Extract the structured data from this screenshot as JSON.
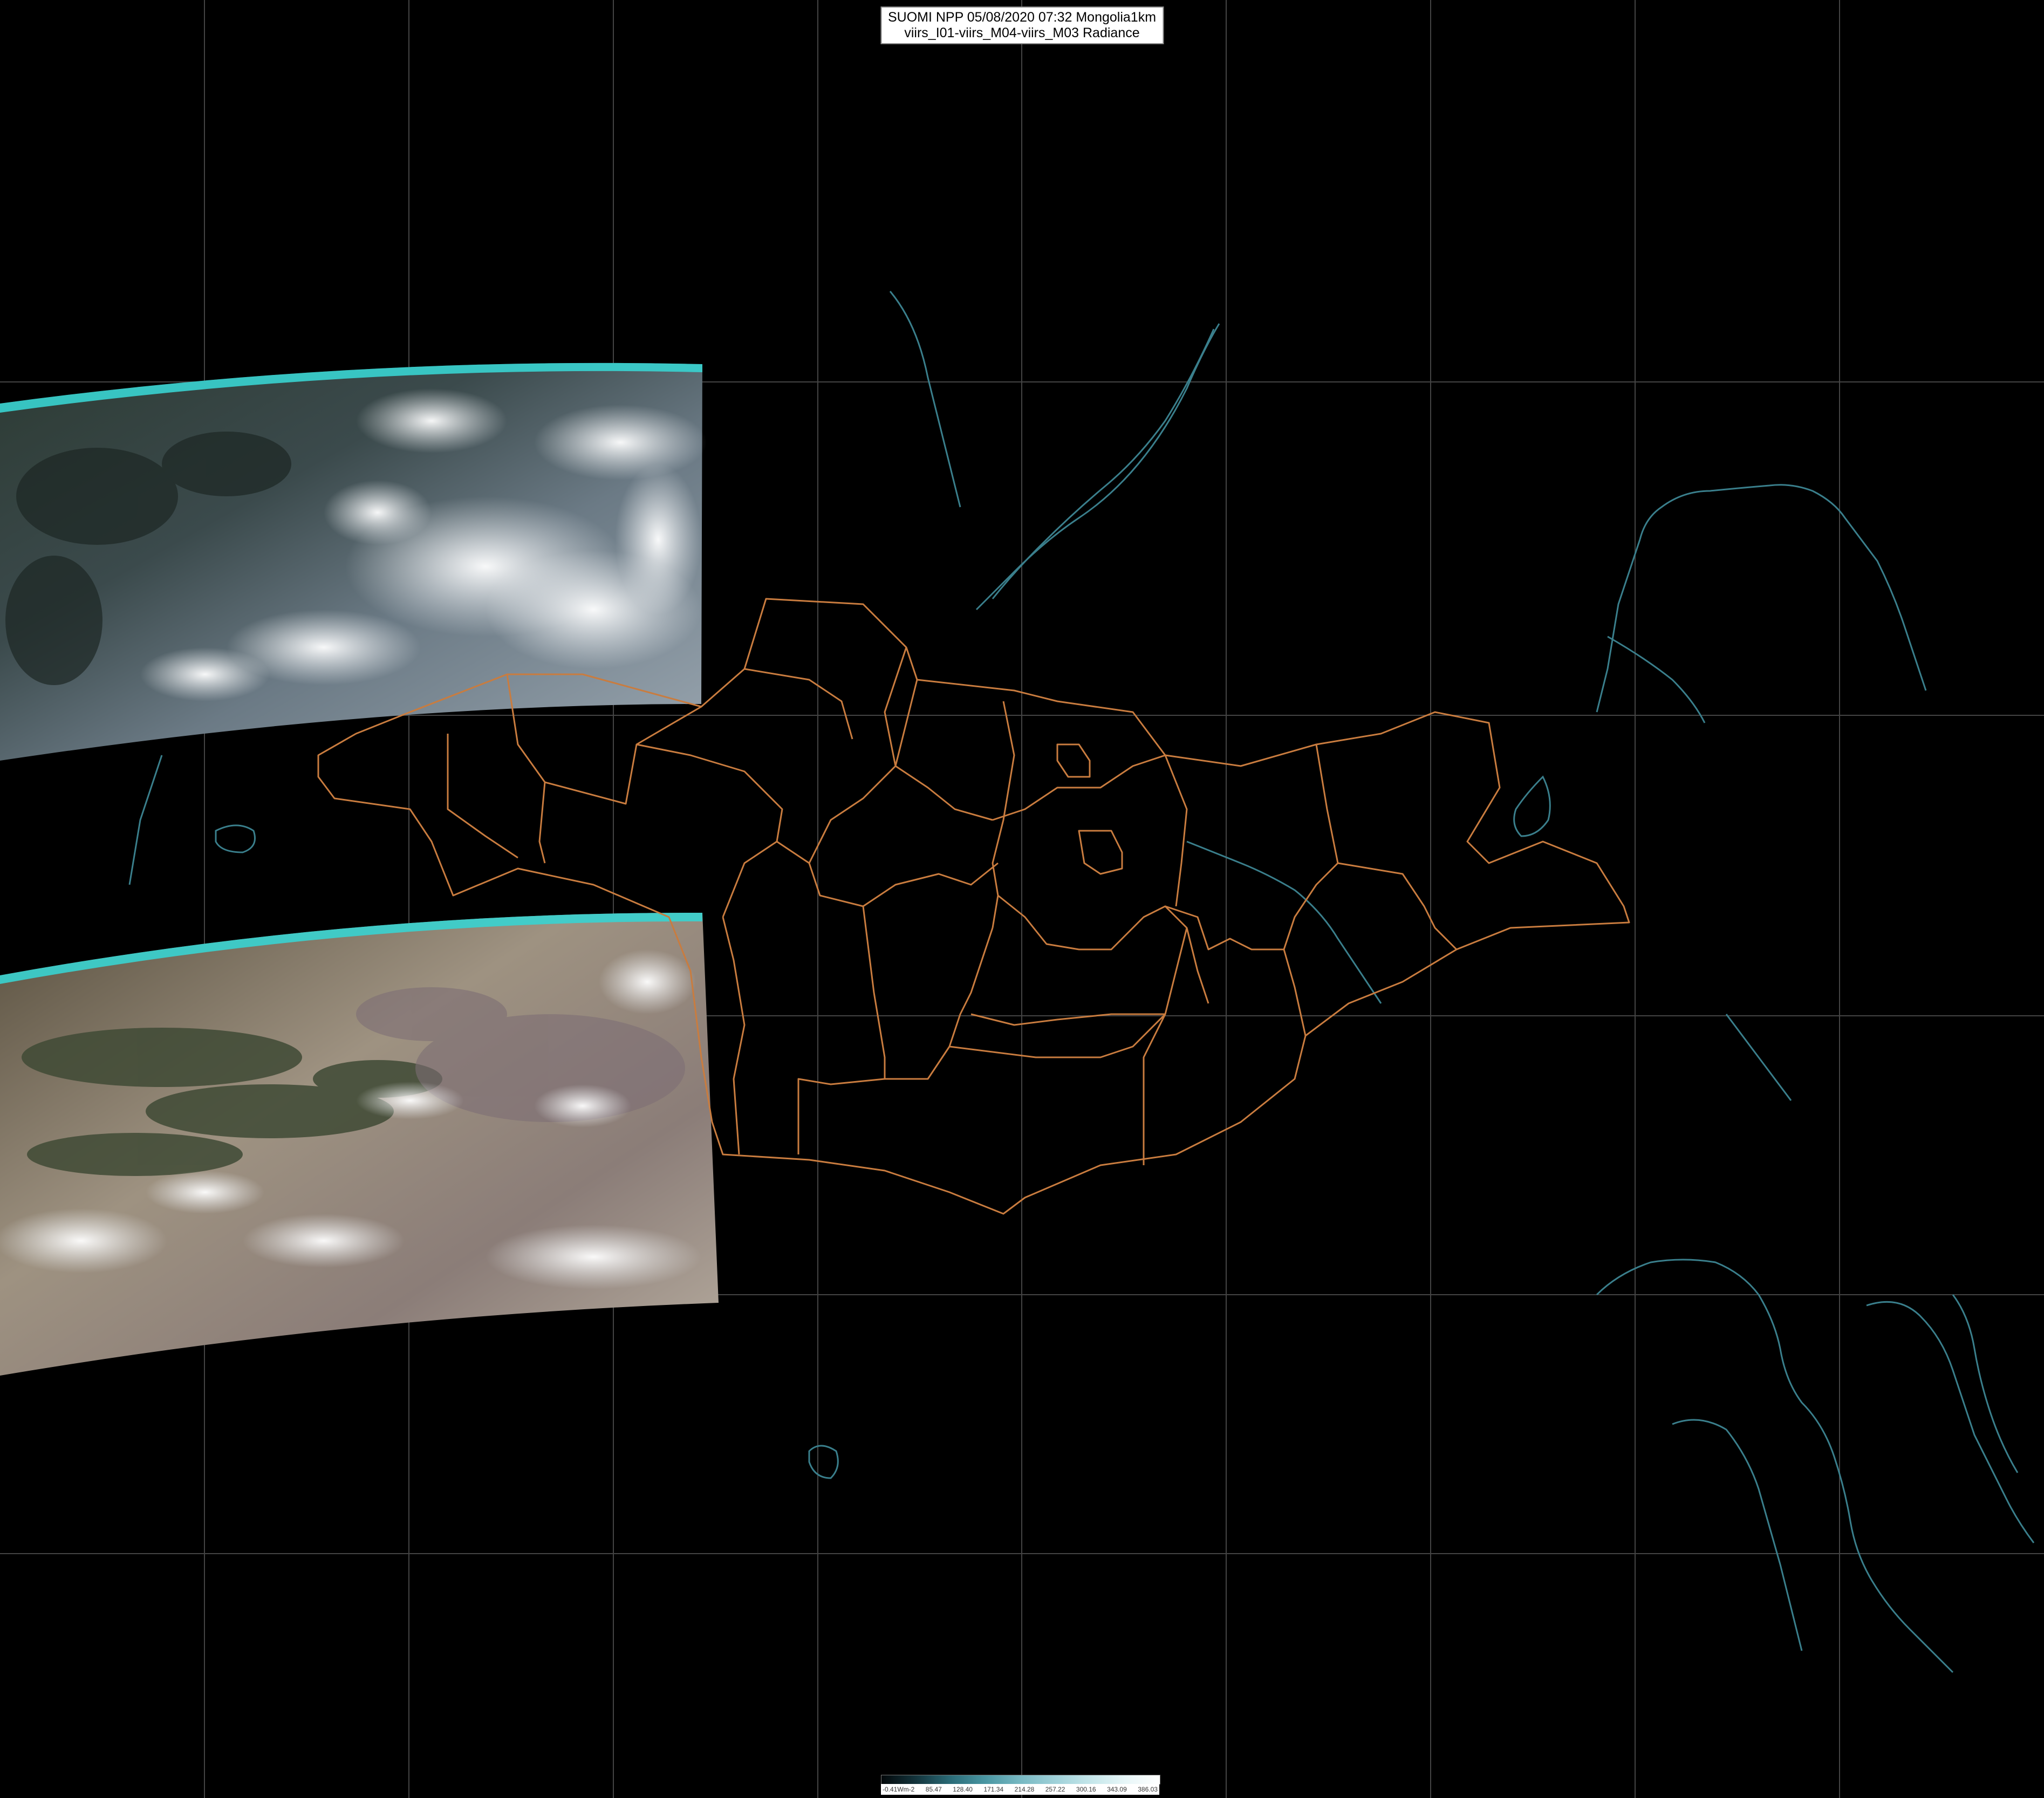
{
  "title": {
    "line1": "SUOMI NPP 05/08/2020 07:32 Mongolia1km",
    "line2": "viirs_I01-viirs_M04-viirs_M03 Radiance"
  },
  "legend": {
    "ticks": [
      "-0.41Wm-2",
      "85.47",
      "128.40",
      "171.34",
      "214.28",
      "257.22",
      "300.16",
      "343.09",
      "386.03"
    ],
    "gradient": [
      "#03080a",
      "#14353d",
      "#2b6c78",
      "#4a97a3",
      "#78b9c3",
      "#9fd1d9",
      "#c4e6ea",
      "#e7f6f8",
      "#ffffff"
    ]
  },
  "colors": {
    "background": "#000000",
    "graticule": "#555555",
    "admin_border": "#c97c3f",
    "coastline": "#3a7f8c",
    "cloud": "#e9ecef",
    "desert": "#a89884",
    "forest": "#3c4b3a",
    "swath_edge": "#39d3d0"
  },
  "layers": [
    "graticule",
    "satellite-swath-north",
    "satellite-swath-south",
    "coastlines",
    "admin-borders"
  ]
}
